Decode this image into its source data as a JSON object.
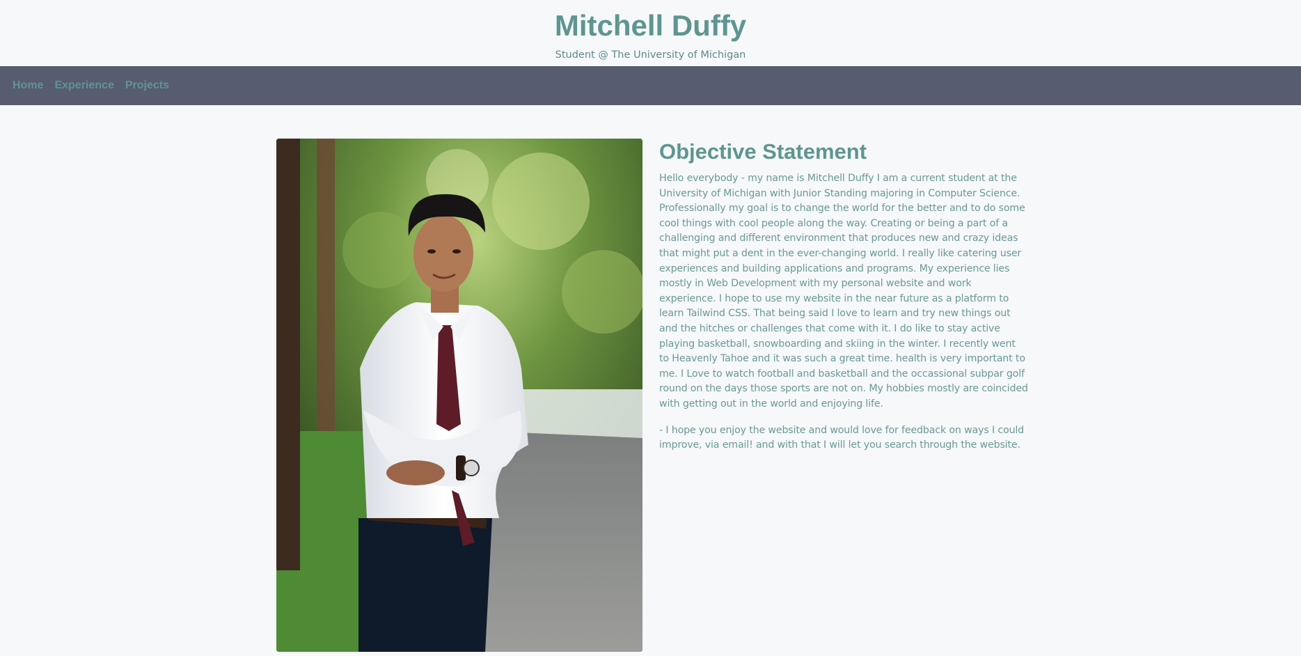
{
  "header": {
    "title": "Mitchell Duffy",
    "subtitle": "Student @ The University of Michigan"
  },
  "nav": {
    "items": [
      {
        "label": "Home"
      },
      {
        "label": "Experience"
      },
      {
        "label": "Projects"
      }
    ]
  },
  "main": {
    "photo_alt": "Portrait of Mitchell Duffy",
    "heading": "Objective Statement",
    "paragraph": "Hello everybody - my name is Mitchell Duffy I am a current student at the University of Michigan with Junior Standing majoring in Computer Science. Professionally my goal is to change the world for the better and to do some cool things with cool people along the way. Creating or being a part of a challenging and different environment that produces new and crazy ideas that might put a dent in the ever-changing world. I really like catering user experiences and building applications and programs. My experience lies mostly in Web Development with my personal website and work experience. I hope to use my website in the near future as a platform to learn Tailwind CSS. That being said I love to learn and try new things out and the hitches or challenges that come with it. I do like to stay active playing basketball, snowboarding and skiing in the winter. I recently went to Heavenly Tahoe and it was such a great time. health is very important to me. I Love to watch football and basketball and the occassional subpar golf round on the days those sports are not on. My hobbies mostly are coincided with getting out in the world and enjoying life.",
    "closing": "- I hope you enjoy the website and would love for feedback on ways I could improve, via email! and with that I will let you search through the website."
  },
  "colors": {
    "accent": "#5f9590",
    "nav_background": "#575c70",
    "page_background": "#f6f8fa"
  }
}
